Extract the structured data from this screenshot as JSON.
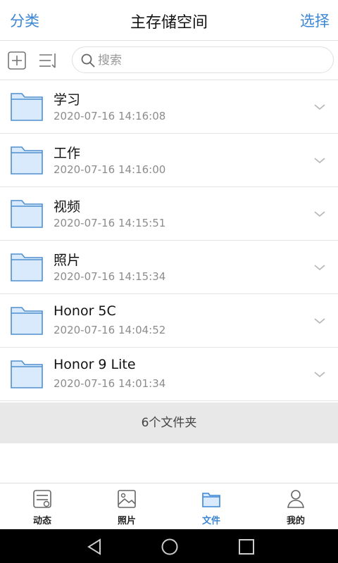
{
  "header": {
    "left_label": "分类",
    "title": "主存储空间",
    "right_label": "选择"
  },
  "toolbar": {
    "add_icon": "plus-box-icon",
    "sort_icon": "sort-list-icon",
    "search_placeholder": "搜索"
  },
  "folders": [
    {
      "name": "学习",
      "time": "2020-07-16 14:16:08"
    },
    {
      "name": "工作",
      "time": "2020-07-16 14:16:00"
    },
    {
      "name": "视频",
      "time": "2020-07-16 14:15:51"
    },
    {
      "name": "照片",
      "time": "2020-07-16 14:15:34"
    },
    {
      "name": "Honor 5C",
      "time": "2020-07-16 14:04:52"
    },
    {
      "name": "Honor 9 Lite",
      "time": "2020-07-16 14:01:34"
    }
  ],
  "summary": "6个文件夹",
  "tabs": [
    {
      "label": "动态",
      "icon": "feed-icon"
    },
    {
      "label": "照片",
      "icon": "photo-icon"
    },
    {
      "label": "文件",
      "icon": "folder-icon",
      "active": true
    },
    {
      "label": "我的",
      "icon": "person-icon"
    }
  ],
  "colors": {
    "accent": "#3a86d4",
    "folder_fill": "#d8eafb",
    "folder_stroke": "#4f8fcf"
  }
}
